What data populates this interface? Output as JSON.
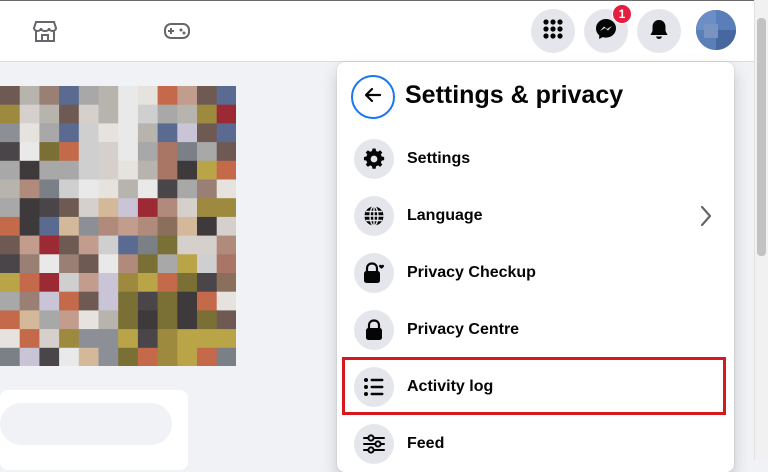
{
  "header": {
    "marketplace_icon": "marketplace-shop-icon",
    "gaming_icon": "gamepad-icon",
    "menu_icon": "grid-menu-icon",
    "messenger_icon": "messenger-icon",
    "messenger_badge": "1",
    "notifications_icon": "bell-icon",
    "avatar": "profile-avatar"
  },
  "panel": {
    "back_icon": "arrow-left-icon",
    "title": "Settings & privacy",
    "items": [
      {
        "label": "Settings",
        "icon": "gear-icon"
      },
      {
        "label": "Language",
        "icon": "globe-icon",
        "has_chevron": true
      },
      {
        "label": "Privacy Checkup",
        "icon": "lock-heart-icon"
      },
      {
        "label": "Privacy Centre",
        "icon": "lock-icon"
      },
      {
        "label": "Activity log",
        "icon": "list-icon",
        "highlighted": true
      },
      {
        "label": "Feed",
        "icon": "sliders-icon"
      }
    ]
  },
  "colors": {
    "accent": "#1877f2",
    "badge": "#e41e3f",
    "highlight_box": "#d7191e",
    "page_bg": "#f0f2f5"
  }
}
